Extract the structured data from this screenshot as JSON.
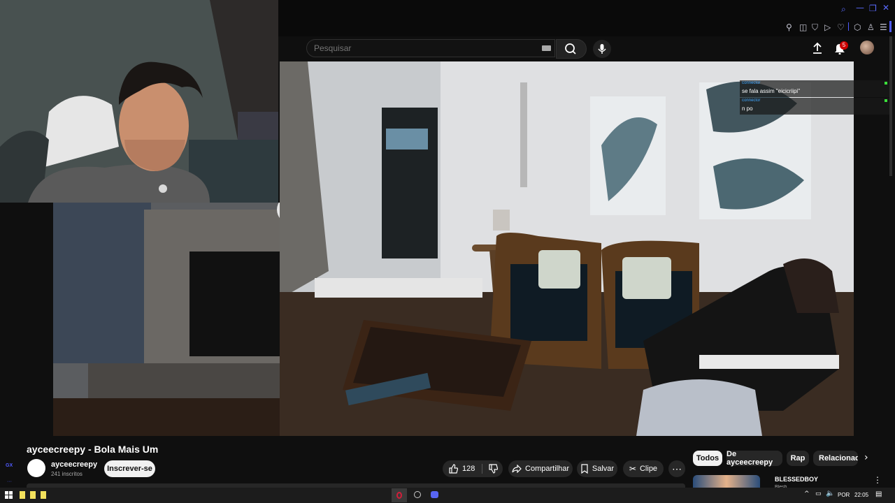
{
  "search": {
    "placeholder": "Pesquisar"
  },
  "header": {
    "notifications_count": "5"
  },
  "chat": [
    {
      "user": "соnnесtor",
      "message": "se fala assim \"eicicriipi\""
    },
    {
      "user": "соnnесtor",
      "message": "n po"
    }
  ],
  "video": {
    "title": "ayceecreepy - Bola Mais Um",
    "channel": "ayceecreepy",
    "subscribers": "241 inscritos",
    "subscribe_label": "Inscrever-se",
    "likes": "128",
    "share_label": "Compartilhar",
    "save_label": "Salvar",
    "clip_label": "Clipe"
  },
  "chips": [
    "Todos",
    "De ayceecreepy",
    "Rap",
    "Relacionado"
  ],
  "recommendation": {
    "title": "BLESSEDBOY",
    "subtitle": "Blesh"
  },
  "side_label": "GX",
  "taskbar": {
    "lang": "POR",
    "time": "22:05"
  },
  "colors": {
    "accent_red": "#ff0000",
    "opera_blue": "#4f5bff",
    "background": "#0f0f0f"
  }
}
